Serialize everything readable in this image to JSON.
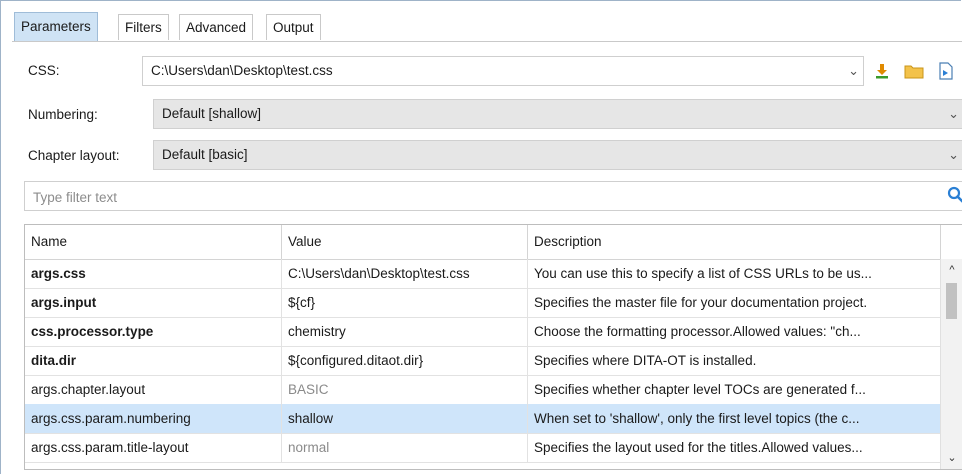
{
  "tabs": [
    {
      "label": "Parameters",
      "active": true
    },
    {
      "label": "Filters",
      "active": false
    },
    {
      "label": "Advanced",
      "active": false
    },
    {
      "label": "Output",
      "active": false
    }
  ],
  "css": {
    "label": "CSS:",
    "value": "C:\\Users\\dan\\Desktop\\test.css",
    "icons": [
      "download-icon",
      "folder-icon",
      "insert-file-icon"
    ]
  },
  "numbering": {
    "label": "Numbering:",
    "value": "Default [shallow]"
  },
  "chapter_layout": {
    "label": "Chapter layout:",
    "value": "Default [basic]"
  },
  "filter": {
    "placeholder": "Type filter text"
  },
  "table": {
    "columns": [
      "Name",
      "Value",
      "Description"
    ],
    "rows": [
      {
        "name": "args.css",
        "value": "C:\\Users\\dan\\Desktop\\test.css",
        "description": "You can use this to specify a list of CSS URLs to be us...",
        "bold": true,
        "value_muted": false,
        "selected": false
      },
      {
        "name": "args.input",
        "value": "${cf}",
        "description": "Specifies the master file for your documentation project.",
        "bold": true,
        "value_muted": false,
        "selected": false
      },
      {
        "name": "css.processor.type",
        "value": "chemistry",
        "description": "Choose the formatting processor.Allowed values:  \"ch...",
        "bold": true,
        "value_muted": false,
        "selected": false
      },
      {
        "name": "dita.dir",
        "value": "${configured.ditaot.dir}",
        "description": "Specifies where DITA-OT is installed.",
        "bold": true,
        "value_muted": false,
        "selected": false
      },
      {
        "name": "args.chapter.layout",
        "value": "BASIC",
        "description": "Specifies whether chapter level TOCs are generated f...",
        "bold": false,
        "value_muted": true,
        "selected": false
      },
      {
        "name": "args.css.param.numbering",
        "value": "shallow",
        "description": "When set to 'shallow', only the first level topics (the c...",
        "bold": false,
        "value_muted": false,
        "selected": true
      },
      {
        "name": "args.css.param.title-layout",
        "value": "normal",
        "description": "Specifies the layout used for the titles.Allowed values...",
        "bold": false,
        "value_muted": true,
        "selected": false
      }
    ]
  },
  "colors": {
    "tab_active": "#cfe3f5",
    "row_selected": "#cfe5fa",
    "accent": "#2a7fd4"
  }
}
